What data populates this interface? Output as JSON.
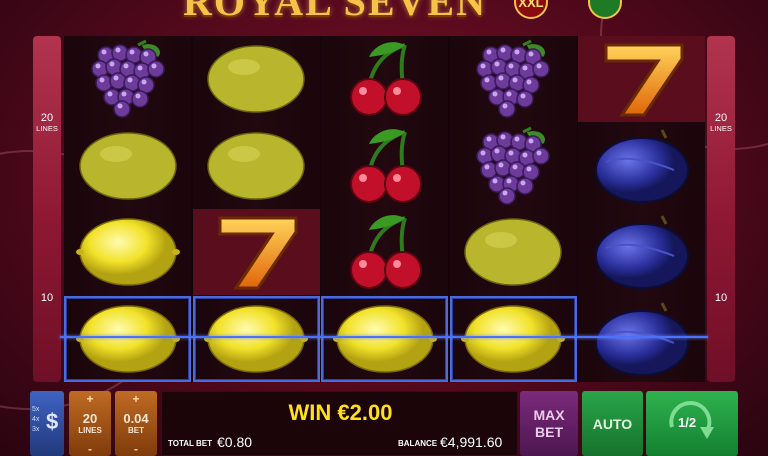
{
  "title": {
    "text": "ROYAL SEVEN",
    "emblem_text": "XXL"
  },
  "side_panels": {
    "left": {
      "top_value": "20",
      "top_unit": "LINES",
      "bottom_value": "10"
    },
    "right": {
      "top_value": "20",
      "top_unit": "LINES",
      "bottom_value": "10"
    }
  },
  "reels": [
    {
      "symbols": [
        "grapes",
        "lemon",
        "lemon",
        "lemon"
      ],
      "winning_rows": [
        3
      ]
    },
    {
      "symbols": [
        "lemon",
        "lemon",
        "seven",
        "lemon"
      ],
      "winning_rows": [
        3
      ]
    },
    {
      "symbols": [
        "cherries",
        "cherries",
        "cherries",
        "lemon"
      ],
      "winning_rows": [
        3
      ]
    },
    {
      "symbols": [
        "grapes",
        "grapes",
        "lemon",
        "lemon"
      ],
      "winning_rows": [
        3
      ]
    },
    {
      "symbols": [
        "seven",
        "plum",
        "plum",
        "plum"
      ],
      "winning_rows": []
    }
  ],
  "controls": {
    "paytable": {
      "lines": [
        "5x",
        "4x",
        "3x"
      ],
      "icon": "dollar-icon"
    },
    "lines": {
      "plus": "+",
      "value": "20",
      "label": "LINES",
      "minus": "-"
    },
    "bet": {
      "plus": "+",
      "value": "0.04",
      "label": "BET",
      "minus": "-"
    },
    "win_label": "WIN €2.00",
    "total_bet_label": "TOTAL BET",
    "total_bet_value": "€0.80",
    "balance_label": "BALANCE",
    "balance_value": "€4,991.60",
    "max_bet_label_1": "MAX",
    "max_bet_label_2": "BET",
    "auto_label": "AUTO",
    "spin_label": "1/2"
  },
  "colors": {
    "win_text": "#ffe01b",
    "payline": "#4a72ff",
    "auto_button": "#2aa54a",
    "max_bet_button": "#7a2a7a",
    "bet_buttons": "#c06b23"
  }
}
